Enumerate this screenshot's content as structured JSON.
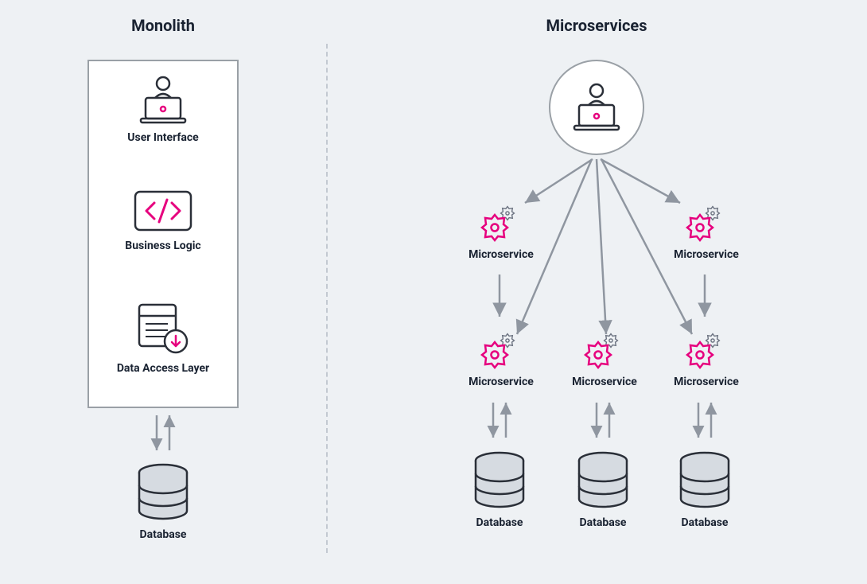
{
  "left": {
    "title": "Monolith",
    "layers": {
      "ui": "User Interface",
      "logic": "Business Logic",
      "data": "Data Access Layer"
    },
    "database": "Database"
  },
  "right": {
    "title": "Microservices",
    "service_label": "Microservice",
    "database": "Database",
    "row1_count": 2,
    "row2_count": 3,
    "db_count": 3
  },
  "colors": {
    "accent": "#e6007e",
    "line": "#8f96a0",
    "stroke": "#2a2f38"
  }
}
